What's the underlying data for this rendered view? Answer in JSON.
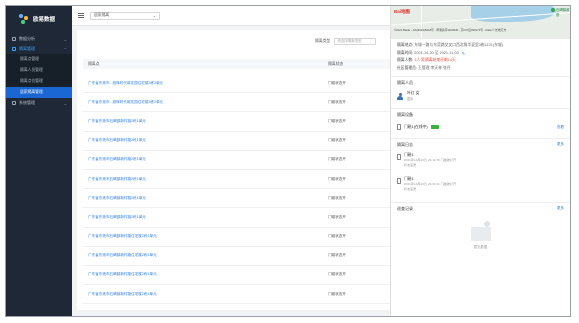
{
  "app": {
    "title": "欧易数据"
  },
  "sidebar": {
    "items": [
      {
        "label": "数据分析",
        "active": false
      },
      {
        "label": "隔离管理",
        "active": true
      }
    ],
    "sub_items": [
      {
        "label": "隔离点管理",
        "active": false
      },
      {
        "label": "隔离人员管理",
        "active": false
      },
      {
        "label": "隔离点位管理",
        "active": false
      },
      {
        "label": "居家隔离管理",
        "active": true
      }
    ],
    "after_items": [
      {
        "label": "系统管理",
        "active": false
      }
    ]
  },
  "topbar": {
    "select_value": "居家隔离"
  },
  "filter": {
    "label": "隔离类型",
    "placeholder": "请选择隔离类型"
  },
  "table": {
    "headers": [
      "隔离点",
      "隔离状态"
    ],
    "rows": [
      {
        "point": "广东省东莞市...旭辉时代城花园住宅楼3栋2单元",
        "status": "门磁状态开"
      },
      {
        "point": "广东省东莞市...旭辉时代城花园住宅楼3栋2单元",
        "status": "门磁状态开"
      },
      {
        "point": "广东省东莞市石碣镇新村路2栋1单元",
        "status": "门磁状态开"
      },
      {
        "point": "广东省东莞市石碣镇新村路2栋1单元",
        "status": "门磁状态开"
      },
      {
        "point": "广东省东莞市石碣镇新村路2栋1单元",
        "status": "门磁状态开"
      },
      {
        "point": "广东省东莞市石碣镇新村路2栋1单元",
        "status": "门磁状态开"
      },
      {
        "point": "广东省东莞市石碣镇新村路2栋1单元",
        "status": "门磁状态开"
      },
      {
        "point": "广东省东莞市石碣镇新村路2栋1单元",
        "status": "门磁状态开"
      },
      {
        "point": "广东省东莞市石碣镇新村路住宅楼2栋1单元",
        "status": "门磁状态开"
      },
      {
        "point": "广东省东莞市石碣镇新村路住宅楼2栋1单元",
        "status": "门磁状态开"
      },
      {
        "point": "广东省东莞市石碣镇新村路住宅楼2栋1单元",
        "status": "门磁状态开"
      },
      {
        "point": "广东省东莞市石碣镇新村路住宅楼2栋1单元",
        "status": "门磁状态开"
      }
    ],
    "pager_text": "共有1,768条"
  },
  "drawer": {
    "map": {
      "baidu_label": "Bai地图",
      "pin_label": "石碣镇政府",
      "scale_text": "©2021 Baidu - GS(2019)5218号 - 甲测资字1100930 - 京ICP证030173号 - Data © 长地万方"
    },
    "info": {
      "address_label": "隔离地点:",
      "address_value": "东城一路与东莞路交叉口西北角华夏里3栋1101(东城)",
      "time_label": "隔离时间:",
      "time_value": "2021-10-20 至 2021-11-03",
      "count_label": "隔离人数:",
      "count_value": "1人",
      "count_warn": "距隔离结束还剩14天",
      "admin_label": "社区管理员:",
      "admin_value": "王管理 李天林 张丹"
    },
    "personnel": {
      "title": "隔离人员",
      "name": "叶红 女",
      "role": "居民"
    },
    "devices": {
      "title": "隔离设备",
      "name": "门磁1(在线中)",
      "link": "查看"
    },
    "logs": {
      "title": "隔离日志",
      "more": "更多",
      "items": [
        {
          "title": "门磁1",
          "sub1": "2021年10月20日 20:11:36 门磁被打开",
          "sub2": "状态变更"
        },
        {
          "title": "门磁1",
          "sub1": "2021年10月20日 20:04:11 门磁被打开",
          "sub2": "状态变更"
        }
      ]
    },
    "records": {
      "title": "巡查记录",
      "more": "更多",
      "empty": "暂无数据"
    }
  }
}
